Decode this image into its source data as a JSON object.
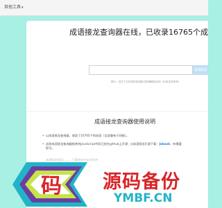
{
  "topbar": {
    "menu_label": "其他工具",
    "caret": "▾"
  },
  "page": {
    "title": "成语接龙查询器在线，已收录16765个成"
  },
  "search": {
    "placeholder": "",
    "button_label": "查询成语",
    "hint": "提示：仅在下方查询的成语即可的哦确定查询（仍然支持声母）"
  },
  "usage": {
    "title": "成语接龙查询器使用说明",
    "items": [
      {
        "text": "以成语接龙查询器，收录了16765个的成语（全部兼有于网络）。"
      },
      {
        "prefix": "这款成语接龙查询器相关的JavaScript代码已经在github上开源：Js成语接龙开源下载：",
        "link": "Jsbook",
        "suffix": "，有需要",
        "cont": "即可。"
      }
    ],
    "faded_line": "本源码的成语……，下载地址在本文档中"
  },
  "watermark": {
    "glyph": "码",
    "cn_text": "源码备份",
    "en_text": "YMBF.CN",
    "colors": {
      "red": "#d8252a",
      "teal": "#22b3c8",
      "lime": "#c7e34a",
      "purple": "#6b3fa0"
    }
  }
}
